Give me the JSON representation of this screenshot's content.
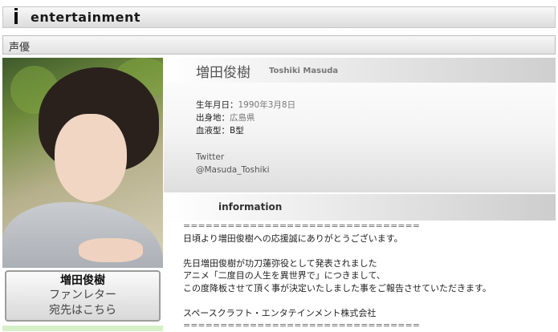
{
  "header": {
    "title": "entertainment"
  },
  "category": {
    "label": "声優"
  },
  "profile": {
    "name_jp": "増田俊樹",
    "name_en": "Toshiki Masuda",
    "birthday_label": "生年月日：",
    "birthday_value": "1990年3月8日",
    "birthplace_label": "出身地：",
    "birthplace_value": "広島県",
    "blood_label": "血液型：",
    "blood_value": "B型",
    "twitter_label": "Twitter",
    "twitter_handle": "@Masuda_Toshiki"
  },
  "fan_letter": {
    "line1": "増田俊樹",
    "line2": "ファンレター",
    "line3": "宛先はこちら"
  },
  "information": {
    "heading": "information",
    "lines": [
      "================================",
      "日頃より増田俊樹への応援誠にありがとうございます。",
      "",
      "先日増田俊樹が功刀蓮弥役として発表されました",
      "アニメ「二度目の人生を異世界で」につきまして、",
      "この度降板させて頂く事が決定いたしました事をご報告させていただきます。",
      "",
      "スペースクラフト・エンタテインメント株式会社",
      "================================"
    ]
  }
}
